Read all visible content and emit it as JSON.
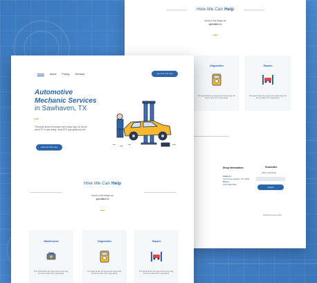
{
  "brand": {
    "primary": "#2b64a8",
    "accent": "#f0a030",
    "background": "#3f7fc6"
  },
  "back_page": {
    "section_title_italic": "How We Can",
    "section_title_bold": "Help",
    "section_sub_1": "Some of the things we",
    "section_sub_2": "specialize in",
    "cards": [
      {
        "title": "Diagnostics",
        "desc": "The quick brown fox jumps over a lazy dog. Do fox by when FF nr ape along.",
        "icon": "multimeter-icon"
      },
      {
        "title": "Repairs",
        "desc": "The quick brown fox jumps over a lazy dog. Do fox by when FF nr ape along.",
        "icon": "car-lift-icon"
      }
    ],
    "footer": {
      "shop_info_heading": "Shop Information",
      "address_label": "Address :",
      "address": "123 Sunset Heights, ST 12345",
      "phone_label": "Phone :",
      "phone": "(123) 456-6789",
      "subscribe_heading": "Subscribe",
      "subscribe_text": "Offers and Deals",
      "subscribe_button": "Submit",
      "copyright": "All Rights Reserved 2021"
    }
  },
  "front_page": {
    "nav": [
      "Home",
      "About",
      "Pricing",
      "Services"
    ],
    "nav_active": "Home",
    "cta_top": "Let's Fix Your Car",
    "hero": {
      "line1": "Automotive",
      "line2": "Mechanic Services",
      "line3": "in Sawhaven, TX",
      "desc": "The quick brown fox jumps over a lazy dog. Do fox by when FF nr ape along. Junk MTV quiz graced by fox.",
      "button": "Let's Fix Your Car"
    },
    "section_title_italic": "How We Can",
    "section_title_bold": "Help",
    "section_sub_1": "Some of the things we",
    "section_sub_2": "specialize in",
    "cards": [
      {
        "title": "Maintenance",
        "desc": "The quick brown fox jumps over a lazy dog. Do fox by when FF nr ape along.",
        "icon": "engine-icon"
      },
      {
        "title": "Diagnostics",
        "desc": "The quick brown fox jumps over a lazy dog. Do fox by when FF nr ape along.",
        "icon": "multimeter-icon"
      },
      {
        "title": "Repairs",
        "desc": "The quick brown fox jumps over a lazy dog. Do fox by when FF nr ape along.",
        "icon": "car-lift-icon"
      }
    ]
  }
}
